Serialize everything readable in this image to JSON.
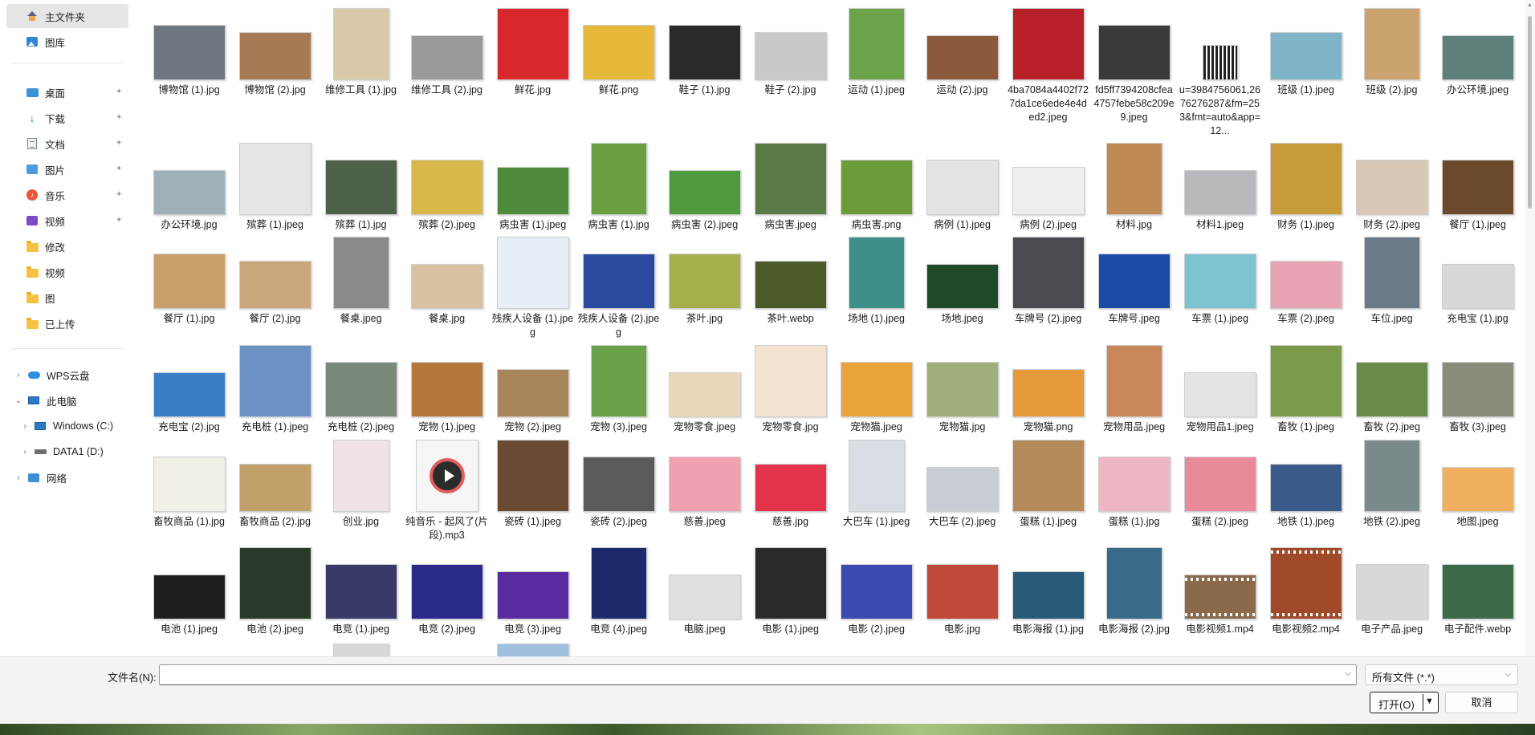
{
  "sidebar": {
    "quick": [
      {
        "label": "主文件夹",
        "icon": "home-icon",
        "selected": true
      },
      {
        "label": "图库",
        "icon": "gallery-icon"
      }
    ],
    "pinned": [
      {
        "label": "桌面",
        "icon": "desktop-icon",
        "pinned": true
      },
      {
        "label": "下载",
        "icon": "download-icon",
        "pinned": true
      },
      {
        "label": "文档",
        "icon": "document-icon",
        "pinned": true
      },
      {
        "label": "图片",
        "icon": "pictures-icon",
        "pinned": true
      },
      {
        "label": "音乐",
        "icon": "music-icon",
        "pinned": true
      },
      {
        "label": "视频",
        "icon": "video-icon",
        "pinned": true
      },
      {
        "label": "修改",
        "icon": "folder-icon"
      },
      {
        "label": "视频",
        "icon": "folder-icon"
      },
      {
        "label": "图",
        "icon": "folder-icon"
      },
      {
        "label": "已上传",
        "icon": "folder-icon"
      }
    ],
    "tree": [
      {
        "label": "WPS云盘",
        "icon": "cloud-icon",
        "expanded": false
      },
      {
        "label": "此电脑",
        "icon": "computer-icon",
        "expanded": true
      },
      {
        "label": "Windows (C:)",
        "icon": "windows-drive-icon",
        "expanded": false
      },
      {
        "label": "DATA1 (D:)",
        "icon": "drive-icon",
        "expanded": false
      },
      {
        "label": "网络",
        "icon": "network-icon",
        "expanded": false
      }
    ]
  },
  "files": [
    [
      {
        "name": "博物馆 (1).jpg",
        "color": "#6f7880"
      },
      {
        "name": "博物馆 (2).jpg",
        "color": "#a57a55"
      },
      {
        "name": "维修工具 (1).jpg",
        "color": "#d9c9a8"
      },
      {
        "name": "维修工具 (2).jpg",
        "color": "#9a9a9a"
      },
      {
        "name": "鲜花.jpg",
        "color": "#d8282c"
      },
      {
        "name": "鲜花.png",
        "color": "#e6b93a"
      },
      {
        "name": "鞋子 (1).jpg",
        "color": "#2a2a2a"
      },
      {
        "name": "鞋子 (2).jpg",
        "color": "#c9c9c9"
      },
      {
        "name": "运动 (1).jpeg",
        "color": "#6aa34a"
      },
      {
        "name": "运动 (2).jpg",
        "color": "#8b5a3c"
      },
      {
        "name": "4ba7084a4402f727da1ce6ede4e4ded2.jpeg",
        "color": "#b8202a"
      },
      {
        "name": "fd5ff7394208cfea4757febe58c209e9.jpeg",
        "color": "#3a3a3a"
      },
      {
        "name": "u=3984756061,2676276287&fm=253&fmt=auto&app=12...",
        "color": "#ffffff",
        "type": "qr"
      },
      {
        "name": "班级 (1).jpeg",
        "color": "#7fb3c7"
      },
      {
        "name": "班级 (2).jpg",
        "color": "#caa36e"
      },
      {
        "name": "办公环境.jpeg",
        "color": "#5e7f7a"
      }
    ],
    [
      {
        "name": "办公环境.jpg",
        "color": "#9fb0b8"
      },
      {
        "name": "殡葬 (1).jpeg",
        "color": "#e5e5e5"
      },
      {
        "name": "殡葬 (1).jpg",
        "color": "#4d6048"
      },
      {
        "name": "殡葬 (2).jpeg",
        "color": "#d8b84a"
      },
      {
        "name": "病虫害 (1).jpeg",
        "color": "#4d8a3a"
      },
      {
        "name": "病虫害 (1).jpg",
        "color": "#6aa040"
      },
      {
        "name": "病虫害 (2).jpeg",
        "color": "#4f9a3e"
      },
      {
        "name": "病虫害.jpeg",
        "color": "#5a7a45"
      },
      {
        "name": "病虫害.png",
        "color": "#6c9b3a"
      },
      {
        "name": "病例 (1).jpeg",
        "color": "#e3e3e3"
      },
      {
        "name": "病例 (2).jpeg",
        "color": "#f0eded"
      },
      {
        "name": "材料.jpg",
        "color": "#c08a55"
      },
      {
        "name": "材料1.jpeg",
        "color": "#b9b9bd"
      },
      {
        "name": "财务 (1).jpeg",
        "color": "#c79a3a"
      },
      {
        "name": "财务 (2).jpeg",
        "color": "#d9c8b5"
      },
      {
        "name": "餐厅 (1).jpeg",
        "color": "#6a4a2a"
      }
    ],
    [
      {
        "name": "餐厅 (1).jpg",
        "color": "#c9a06a"
      },
      {
        "name": "餐厅 (2).jpg",
        "color": "#caa77a"
      },
      {
        "name": "餐桌.jpeg",
        "color": "#8a8a8a"
      },
      {
        "name": "餐桌.jpg",
        "color": "#d8c2a2"
      },
      {
        "name": "残疾人设备 (1).jpeg",
        "color": "#e8eef5"
      },
      {
        "name": "残疾人设备 (2).jpeg",
        "color": "#2a4aa0"
      },
      {
        "name": "茶叶.jpg",
        "color": "#a6b04a"
      },
      {
        "name": "茶叶.webp",
        "color": "#4c5a2a"
      },
      {
        "name": "场地 (1).jpeg",
        "color": "#3e8f8a"
      },
      {
        "name": "场地.jpeg",
        "color": "#1f4a2a"
      },
      {
        "name": "车牌号 (2).jpeg",
        "color": "#4a4a50"
      },
      {
        "name": "车牌号.jpeg",
        "color": "#1a4aa6"
      },
      {
        "name": "车票 (1).jpeg",
        "color": "#7cc2d0"
      },
      {
        "name": "车票 (2).jpeg",
        "color": "#e8a3b5"
      },
      {
        "name": "车位.jpeg",
        "color": "#6a7a88"
      },
      {
        "name": "充电宝 (1).jpg",
        "color": "#d8d8d8"
      }
    ],
    [
      {
        "name": "充电宝 (2).jpg",
        "color": "#3a7ec7"
      },
      {
        "name": "充电桩 (1).jpeg",
        "color": "#6a93c4"
      },
      {
        "name": "充电桩 (2).jpeg",
        "color": "#7a8a7a"
      },
      {
        "name": "宠物 (1).jpeg",
        "color": "#b5773a"
      },
      {
        "name": "宠物 (2).jpeg",
        "color": "#a7865a"
      },
      {
        "name": "宠物 (3).jpeg",
        "color": "#6aa04a"
      },
      {
        "name": "宠物零食.jpeg",
        "color": "#e8d7b8"
      },
      {
        "name": "宠物零食.jpg",
        "color": "#f2e2cf"
      },
      {
        "name": "宠物猫.jpeg",
        "color": "#e8a43a"
      },
      {
        "name": "宠物猫.jpg",
        "color": "#9fae7a"
      },
      {
        "name": "宠物猫.png",
        "color": "#e79a3a"
      },
      {
        "name": "宠物用品.jpeg",
        "color": "#c9875a"
      },
      {
        "name": "宠物用品1.jpeg",
        "color": "#e3e3e3"
      },
      {
        "name": "畜牧 (1).jpeg",
        "color": "#7a9a4a"
      },
      {
        "name": "畜牧 (2).jpeg",
        "color": "#6a8a4a"
      },
      {
        "name": "畜牧 (3).jpeg",
        "color": "#8a8a7a"
      }
    ],
    [
      {
        "name": "畜牧商品 (1).jpg",
        "color": "#f2efe6"
      },
      {
        "name": "畜牧商品 (2).jpg",
        "color": "#c2a06a"
      },
      {
        "name": "创业.jpg",
        "color": "#f1e3e3"
      },
      {
        "name": "纯音乐 - 起风了(片段).mp3",
        "color": "#f5f5f5",
        "type": "audio"
      },
      {
        "name": "瓷砖 (1).jpeg",
        "color": "#6a4a32"
      },
      {
        "name": "瓷砖 (2).jpeg",
        "color": "#5a5a5a"
      },
      {
        "name": "慈善.jpeg",
        "color": "#f0a0ae"
      },
      {
        "name": "慈善.jpg",
        "color": "#e2334a"
      },
      {
        "name": "大巴车 (1).jpeg",
        "color": "#d7dde3"
      },
      {
        "name": "大巴车 (2).jpeg",
        "color": "#c7cdd3"
      },
      {
        "name": "蛋糕 (1).jpeg",
        "color": "#b48a5a"
      },
      {
        "name": "蛋糕 (1).jpg",
        "color": "#ecb6c2"
      },
      {
        "name": "蛋糕 (2).jpeg",
        "color": "#e88a9a"
      },
      {
        "name": "地铁 (1).jpeg",
        "color": "#3a5a8a"
      },
      {
        "name": "地铁 (2).jpeg",
        "color": "#7a8a8a"
      },
      {
        "name": "地图.jpeg",
        "color": "#f0b060"
      }
    ],
    [
      {
        "name": "电池 (1).jpeg",
        "color": "#1f1f1f"
      },
      {
        "name": "电池 (2).jpeg",
        "color": "#2a3a2a"
      },
      {
        "name": "电竞 (1).jpeg",
        "color": "#3a3a6a"
      },
      {
        "name": "电竞 (2).jpeg",
        "color": "#2a2a8a"
      },
      {
        "name": "电竞 (3).jpeg",
        "color": "#5a2aa0"
      },
      {
        "name": "电竞 (4).jpeg",
        "color": "#1a2a6a"
      },
      {
        "name": "电脑.jpeg",
        "color": "#e0e0e0"
      },
      {
        "name": "电影 (1).jpeg",
        "color": "#2a2a2a"
      },
      {
        "name": "电影 (2).jpeg",
        "color": "#3a4ab0"
      },
      {
        "name": "电影.jpg",
        "color": "#c04a3a"
      },
      {
        "name": "电影海报 (1).jpg",
        "color": "#2a5a7a"
      },
      {
        "name": "电影海报 (2).jpg",
        "color": "#3a6a8a"
      },
      {
        "name": "电影视频1.mp4",
        "color": "#8a6a4a",
        "type": "video"
      },
      {
        "name": "电影视频2.mp4",
        "color": "#a04a2a",
        "type": "video"
      },
      {
        "name": "电子产品.jpeg",
        "color": "#d8d8d8"
      },
      {
        "name": "电子配件.webp",
        "color": "#3a6a4a"
      }
    ],
    [
      {
        "name": "",
        "color": "#e0c070"
      },
      {
        "name": "",
        "color": "#e8c0c0"
      },
      {
        "name": "",
        "color": "#d8d8d8"
      },
      {
        "name": "",
        "color": "#e0a070"
      },
      {
        "name": "",
        "color": "#a0c0e0"
      }
    ]
  ],
  "footer": {
    "filename_label": "文件名(N):",
    "filename_value": "",
    "filetype": "所有文件 (*.*)",
    "open_label": "打开(O)",
    "cancel_label": "取消"
  }
}
